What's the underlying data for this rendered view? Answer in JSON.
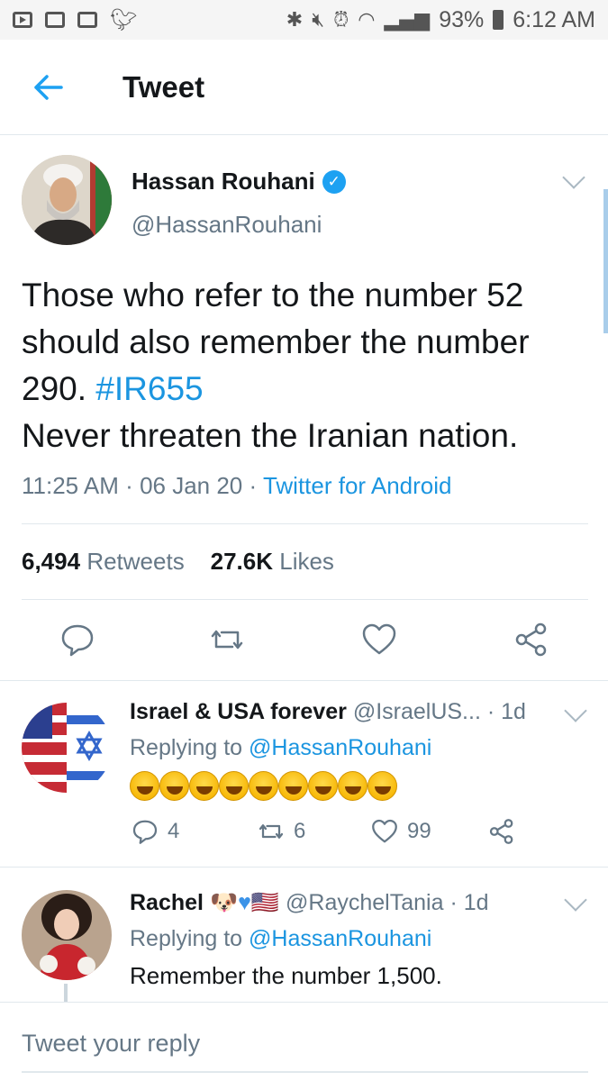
{
  "status_bar": {
    "battery": "93%",
    "time": "6:12 AM"
  },
  "header": {
    "title": "Tweet"
  },
  "tweet": {
    "author_name": "Hassan Rouhani",
    "author_handle": "@HassanRouhani",
    "text_line1": "Those who refer to the number 52",
    "text_line2": "should also remember the number",
    "text_line3_prefix": "290. ",
    "hashtag": "#IR655",
    "text_line4": "Never threaten the Iranian nation.",
    "time": "11:25 AM",
    "date": "06 Jan 20",
    "source": "Twitter for Android",
    "retweets_count": "6,494",
    "retweets_label": "Retweets",
    "likes_count": "27.6K",
    "likes_label": "Likes"
  },
  "replies": [
    {
      "name": "Israel & USA forever",
      "handle": "@IsraelUS...",
      "age": "1d",
      "replying_prefix": "Replying to",
      "replying_to": "@HassanRouhani",
      "reply_count": "4",
      "retweet_count": "6",
      "like_count": "99"
    },
    {
      "name": "Rachel",
      "handle": "@RaychelTania",
      "age": "1d",
      "replying_prefix": "Replying to",
      "replying_to": "@HassanRouhani",
      "text": "Remember the number 1,500."
    }
  ],
  "compose": {
    "placeholder": "Tweet your reply"
  },
  "colors": {
    "accent": "#1da1f2",
    "link": "#1b95e0",
    "secondary_text": "#657786",
    "divider": "#e1e8ed"
  }
}
